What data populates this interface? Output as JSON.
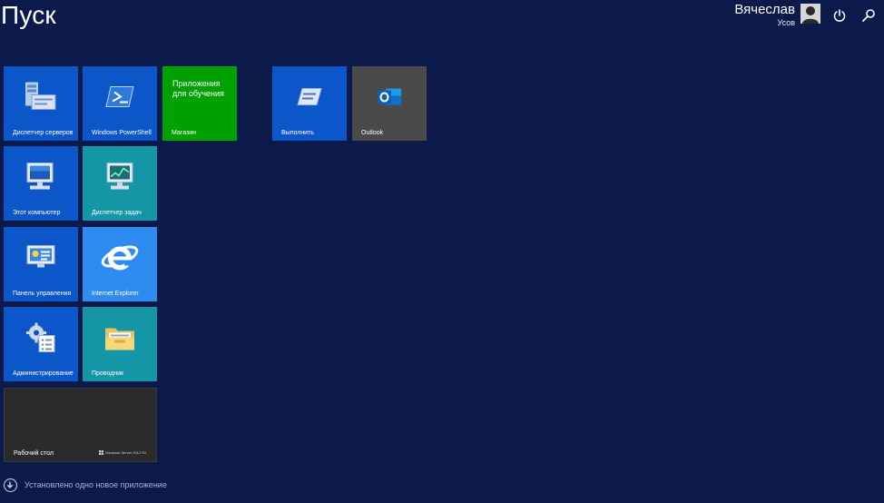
{
  "screen": {
    "title": "Пуск"
  },
  "user": {
    "first": "Вячеслав",
    "last": "Усов"
  },
  "status": {
    "text": "Установлено одно новое приложение"
  },
  "tiles": {
    "server_manager": "Диспетчер серверов",
    "powershell": "Windows PowerShell",
    "store_title": "Приложения для обучения",
    "store": "Магазин",
    "run": "Выполнить",
    "outlook": "Outlook",
    "this_pc": "Этот компьютер",
    "task_manager": "Диспетчер задач",
    "control_panel": "Панель управления",
    "ie": "Internet Explorer",
    "admin": "Администрирование",
    "explorer": "Проводник",
    "desktop": "Рабочий стол",
    "desktop_brand": "Windows Server 2012 R2"
  },
  "colors": {
    "background": "#0b1a4a",
    "tile_blue": "#0b56c8",
    "tile_teal": "#1496a7",
    "tile_green": "#00a000",
    "tile_gray": "#4a4a4a",
    "tile_desktop": "#2b2b2b",
    "ie_blue": "#2e8bf0"
  }
}
